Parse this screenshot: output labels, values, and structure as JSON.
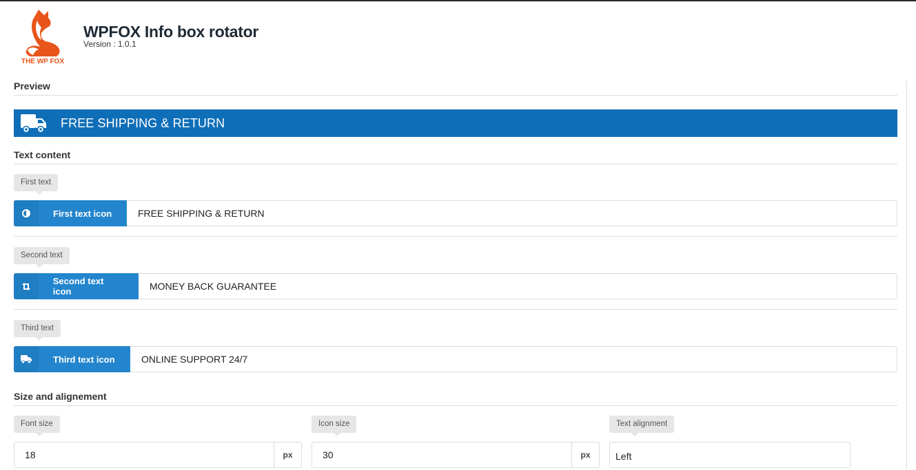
{
  "app": {
    "logo_text": "THE WP FOX",
    "title": "WPFOX Info box rotator",
    "version": "Version : 1.0.1",
    "brand_color": "#e8551a"
  },
  "sections": {
    "preview": "Preview",
    "text_content": "Text content",
    "size_alignment": "Size and alignement"
  },
  "preview": {
    "icon": "truck-icon",
    "text": "FREE SHIPPING & RETURN",
    "background": "#0f6eb8"
  },
  "texts": [
    {
      "tag": "First text",
      "button_label": "First text icon",
      "icon": "adjust-icon",
      "value": "FREE SHIPPING & RETURN"
    },
    {
      "tag": "Second text",
      "button_label": "Second text icon",
      "icon": "retweet-icon",
      "value": "MONEY BACK GUARANTEE"
    },
    {
      "tag": "Third text",
      "button_label": "Third text icon",
      "icon": "truck-icon",
      "value": "ONLINE SUPPORT 24/7"
    }
  ],
  "size": {
    "font_size": {
      "label": "Font size",
      "value": "18",
      "unit": "px"
    },
    "icon_size": {
      "label": "Icon size",
      "value": "30",
      "unit": "px"
    },
    "text_alignment": {
      "label": "Text alignment",
      "value": "Left"
    }
  },
  "colors": {
    "accent": "#2385cd"
  }
}
